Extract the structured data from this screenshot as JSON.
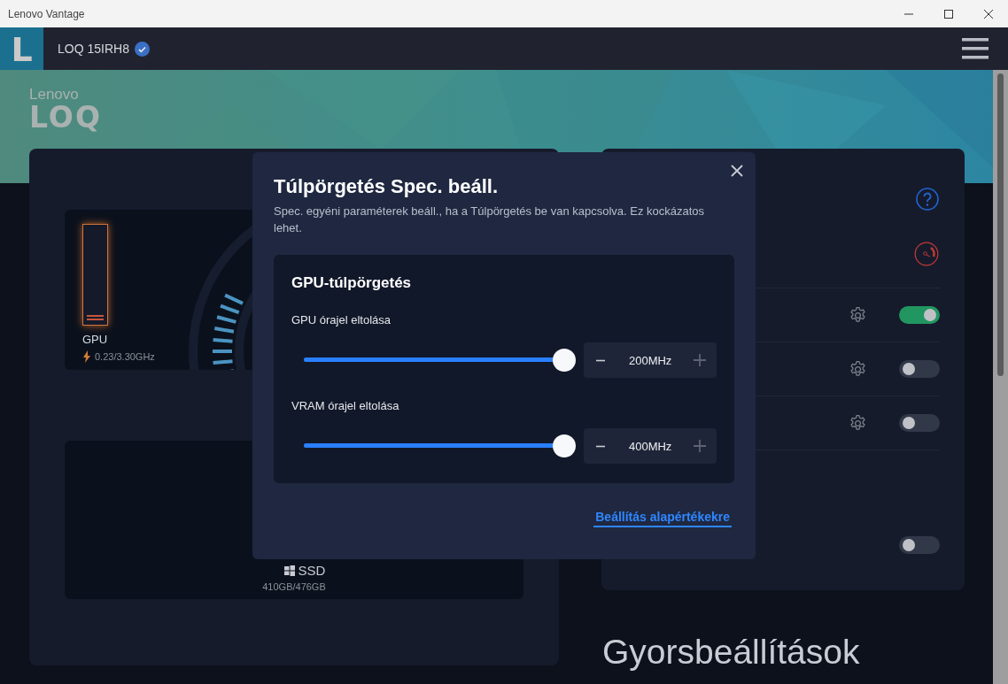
{
  "window": {
    "title": "Lenovo Vantage"
  },
  "header": {
    "app_logo": "L",
    "device": "LOQ 15IRH8",
    "verified": true
  },
  "brand": {
    "line1": "Lenovo",
    "line2": "LOQ"
  },
  "monitor": {
    "gpu": {
      "label": "GPU",
      "level": 0.06,
      "reading": "0.23/3.30GHz"
    },
    "storage": {
      "label": "SSD",
      "reading": "410GB/476GB"
    }
  },
  "settings": {
    "toggles": [
      {
        "kind": "gear",
        "on": true
      },
      {
        "kind": "gear",
        "on": false
      },
      {
        "kind": "gear",
        "on": false
      },
      {
        "kind": "plain",
        "on": false
      }
    ]
  },
  "quick_settings": {
    "title": "Gyorsbeállítások"
  },
  "dialog": {
    "title": "Túlpörgetés Spec. beáll.",
    "description": "Spec. egyéni paraméterek beáll., ha a Túlpörgetés be van kapcsolva. Ez kockázatos lehet.",
    "section": {
      "title": "GPU-túlpörgetés",
      "sliders": [
        {
          "label": "GPU órajel eltolása",
          "level": 1,
          "value": "200MHz"
        },
        {
          "label": "VRAM órajel eltolása",
          "level": 1,
          "value": "400MHz"
        }
      ]
    },
    "reset_link": "Beállítás alapértékekre"
  }
}
